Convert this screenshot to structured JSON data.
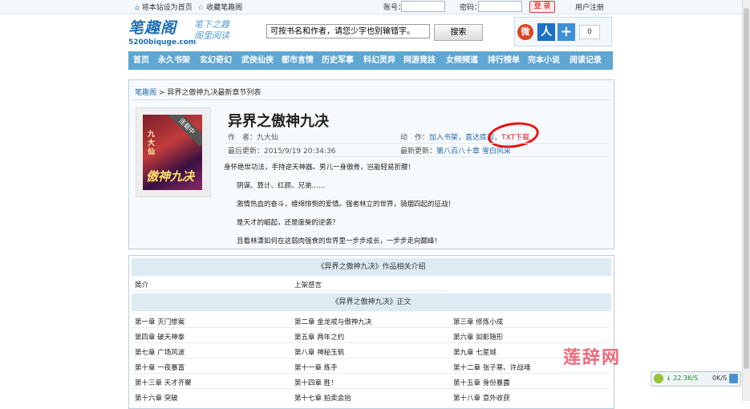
{
  "topbar": {
    "set_home": "将本站设为首页",
    "bookmark": "收藏笔趣阁",
    "account_label": "账号：",
    "password_label": "密码：",
    "login_button": "登 录",
    "register": "用户注册"
  },
  "header": {
    "logo_text": "笔趣阁",
    "logo_url": "5200biquge.com",
    "slogan_1": "笔下之趣",
    "slogan_2": "阁里阅读",
    "search_placeholder": "可按书名和作者，请您少字也别输错字。",
    "search_button": "搜索",
    "share_count": "0",
    "share_weibo": "微",
    "share_renren": "人",
    "share_plus": "+"
  },
  "nav": [
    "首页",
    "永久书架",
    "玄幻奇幻",
    "武侠仙侠",
    "都市言情",
    "历史军事",
    "科幻灵异",
    "网游竞技",
    "女频频道",
    "排行榜单",
    "完本小说",
    "阅读记录"
  ],
  "breadcrumb": {
    "home": "笔趣阁",
    "sep": ">",
    "current": "异界之傲神九决最新章节列表"
  },
  "book": {
    "cover_ribbon": "连载中",
    "cover_side": "九大仙",
    "cover_title": "傲神九决",
    "title": "异界之傲神九决",
    "author_label": "作　者：",
    "author": "九大仙",
    "action_label": "动　作：",
    "add_shelf": "加入书架",
    "comma": "，",
    "to_bottom": "直达底部",
    "txt_download": "TXT下载",
    "updated_label": "最后更新：",
    "updated": "2015/9/19 20:34:36",
    "latest_label": "最新更新：",
    "latest_chapter": "第八百八十章 雪白风采",
    "intro": [
      "身怀绝世功法，手持逆天神器。男儿一身傲骨，岂能轻易折腰！",
      "阴谋、算计、红颜、兄弟……",
      "激情热血的奋斗，缠绵悱恻的爱情。强者林立的世界，骑烟四起的征战！",
      "是天才的崛起，还是废柴的逆袭？",
      "且看林潇如何在这弱肉强食的世界里一步步成长，一步步走向巅峰！"
    ]
  },
  "chapters_box": {
    "related_header": "《异界之傲神九决》作品相关介绍",
    "related": [
      "简介",
      "上架感言"
    ],
    "main_header": "《异界之傲神九决》正文",
    "rows": [
      [
        "第一章 灭门惨案",
        "第二章 金龙戒与傲神九决",
        "第三章 修炼小成"
      ],
      [
        "第四章 破天神拳",
        "第五章 两年之约",
        "第六章 如影随形"
      ],
      [
        "第七章 广场风波",
        "第八章 神秘玉佩",
        "第九章 七星城"
      ],
      [
        "第十章 一夜暴富",
        "第十一章 练手",
        "第十二章 张子寒、许战魂"
      ],
      [
        "第十三章 天才齐聚",
        "第十四章 胜！",
        "第十五章 身份暴露"
      ],
      [
        "第十六章 突破",
        "第十七章 拍卖会抬",
        "第十八章 意外收获"
      ]
    ]
  },
  "overlay": {
    "watermark": "莲辞网",
    "down_speed": "↓ 22.3K/S",
    "up_speed": "0K/S"
  }
}
